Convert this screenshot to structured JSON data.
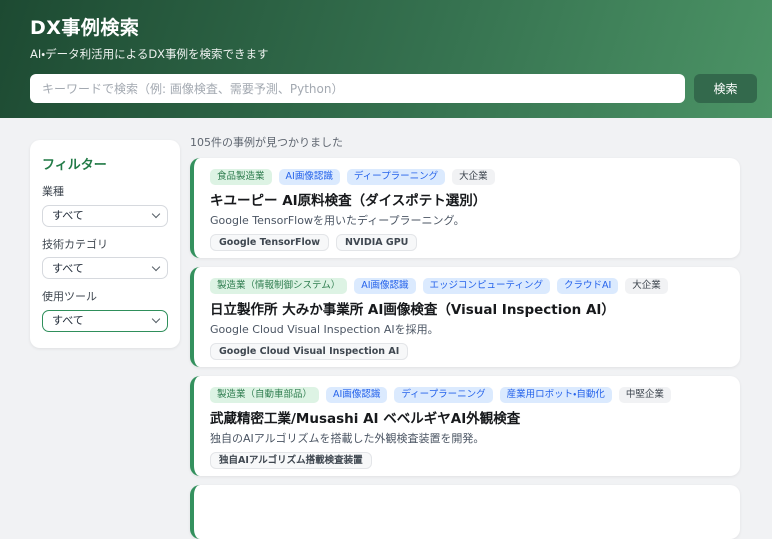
{
  "header": {
    "title": "DX事例検索",
    "subtitle": "AI・データ利活用によるDX事例を検索できます",
    "search_placeholder": "キーワードで検索（例: 画像検査、需要予測、Python）",
    "search_button": "検索"
  },
  "filters": {
    "title": "フィルター",
    "fields": [
      {
        "label": "業種",
        "value": "すべて"
      },
      {
        "label": "技術カテゴリ",
        "value": "すべて"
      },
      {
        "label": "使用ツール",
        "value": "すべて"
      }
    ]
  },
  "results": {
    "count_text": "105件の事例が見つかりました",
    "cases": [
      {
        "tags": [
          {
            "label": "食品製造業",
            "type": "green"
          },
          {
            "label": "AI画像認識",
            "type": "blue"
          },
          {
            "label": "ディープラーニング",
            "type": "blue"
          },
          {
            "label": "大企業",
            "type": "gray"
          }
        ],
        "title": "キユーピー AI原料検査（ダイスポテト選別）",
        "description": "Google TensorFlowを用いたディープラーニング。",
        "tools": [
          "Google TensorFlow",
          "NVIDIA GPU"
        ]
      },
      {
        "tags": [
          {
            "label": "製造業（情報制御システム）",
            "type": "green"
          },
          {
            "label": "AI画像認識",
            "type": "blue"
          },
          {
            "label": "エッジコンピューティング",
            "type": "blue"
          },
          {
            "label": "クラウドAI",
            "type": "blue"
          },
          {
            "label": "大企業",
            "type": "gray"
          }
        ],
        "title": "日立製作所 大みか事業所 AI画像検査（Visual Inspection AI）",
        "description": "Google Cloud Visual Inspection AIを採用。",
        "tools": [
          "Google Cloud Visual Inspection AI"
        ]
      },
      {
        "tags": [
          {
            "label": "製造業（自動車部品）",
            "type": "green"
          },
          {
            "label": "AI画像認識",
            "type": "blue"
          },
          {
            "label": "ディープラーニング",
            "type": "blue"
          },
          {
            "label": "産業用ロボット・自動化",
            "type": "blue"
          },
          {
            "label": "中堅企業",
            "type": "gray"
          }
        ],
        "title": "武蔵精密工業/Musashi AI ベベルギヤAI外観検査",
        "description": "独自のAIアルゴリズムを搭載した外観検査装置を開発。",
        "tools": [
          "独自AIアルゴリズム搭載検査装置"
        ]
      }
    ]
  },
  "colors": {
    "header_gradient_start": "#1d4a32",
    "header_gradient_end": "#4c9466",
    "search_button_bg": "#33694c",
    "accent_green": "#34915e",
    "tag_green_bg": "#ddf3e4",
    "tag_blue_bg": "#dbeafe",
    "tag_gray_bg": "#f1f2f4",
    "page_background": "#f1f2f4"
  }
}
